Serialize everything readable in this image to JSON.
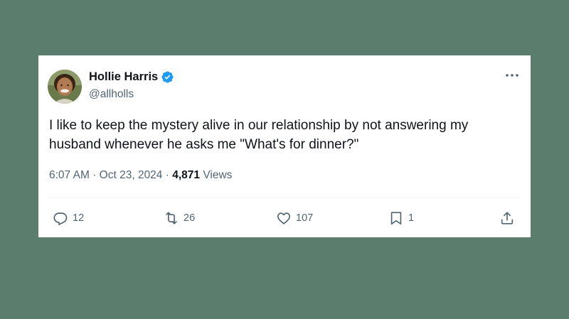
{
  "tweet": {
    "author_name": "Hollie Harris",
    "author_handle": "@allholls",
    "text": "I like to keep the mystery alive in our relationship by not answering my husband whenever he asks me \"What's for dinner?\"",
    "time": "6:07 AM",
    "date": "Oct 23, 2024",
    "views_count": "4,871",
    "views_label": "Views",
    "separator": "·"
  },
  "actions": {
    "replies": "12",
    "reposts": "26",
    "likes": "107",
    "bookmarks": "1"
  },
  "icons": [
    "verified-badge-icon",
    "more-icon",
    "reply-icon",
    "repost-icon",
    "like-icon",
    "bookmark-icon",
    "share-icon"
  ],
  "colors": {
    "background": "#5b7d6d",
    "card": "#ffffff",
    "verified": "#1d9bf0",
    "text": "#0f1419",
    "muted": "#536471"
  }
}
